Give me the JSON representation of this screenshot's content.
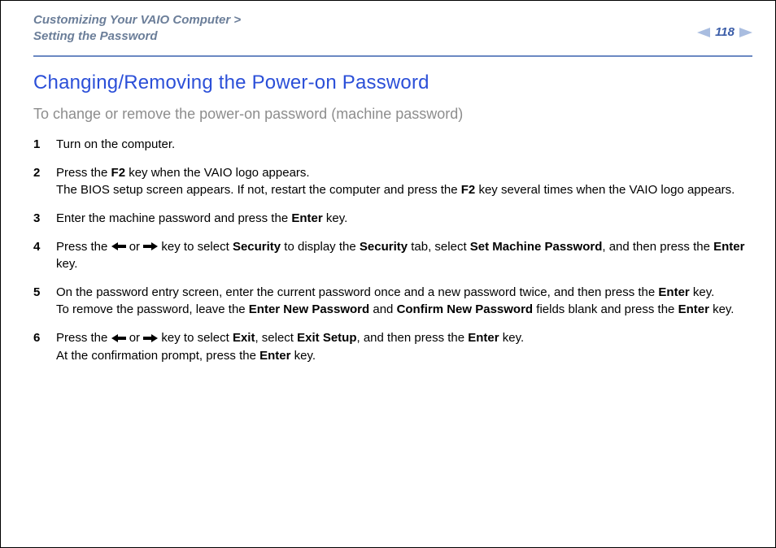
{
  "breadcrumb": {
    "line1_prefix": "Customizing Your VAIO Computer",
    "gt": " >",
    "line2": "Setting the Password"
  },
  "page_number": "118",
  "title": "Changing/Removing the Power-on Password",
  "subhead": "To change or remove the power-on password (machine password)",
  "steps": {
    "s1": {
      "num": "1",
      "text": "Turn on the computer."
    },
    "s2": {
      "num": "2",
      "a": "Press the ",
      "b1": "F2",
      "c": " key when the VAIO logo appears.",
      "d": "The BIOS setup screen appears. If not, restart the computer and press the ",
      "b2": "F2",
      "e": " key several times when the VAIO logo appears."
    },
    "s3": {
      "num": "3",
      "a": "Enter the machine password and press the ",
      "b": "Enter",
      "c": " key."
    },
    "s4": {
      "num": "4",
      "a": "Press the ",
      "b_or": " or ",
      "c": " key to select ",
      "sec": "Security",
      "d": " to display the ",
      "sectab": "Security",
      "e": " tab, select ",
      "smp": "Set Machine Password",
      "f": ", and then press the ",
      "enter": "Enter",
      "g": " key."
    },
    "s5": {
      "num": "5",
      "a": "On the password entry screen, enter the current password once and a new password twice, and then press the ",
      "enter1": "Enter",
      "b": " key.",
      "c": "To remove the password, leave the ",
      "enp": "Enter New Password",
      "d": " and ",
      "cnp": "Confirm New Password",
      "e": " fields blank and press the ",
      "enter2": "Enter",
      "f": " key."
    },
    "s6": {
      "num": "6",
      "a": "Press the ",
      "b_or": " or ",
      "c": " key to select ",
      "exit": "Exit",
      "d": ", select ",
      "exitsetup": "Exit Setup",
      "e": ", and then press the ",
      "enter1": "Enter",
      "f": " key.",
      "g": "At the confirmation prompt, press the ",
      "enter2": "Enter",
      "h": " key."
    }
  }
}
